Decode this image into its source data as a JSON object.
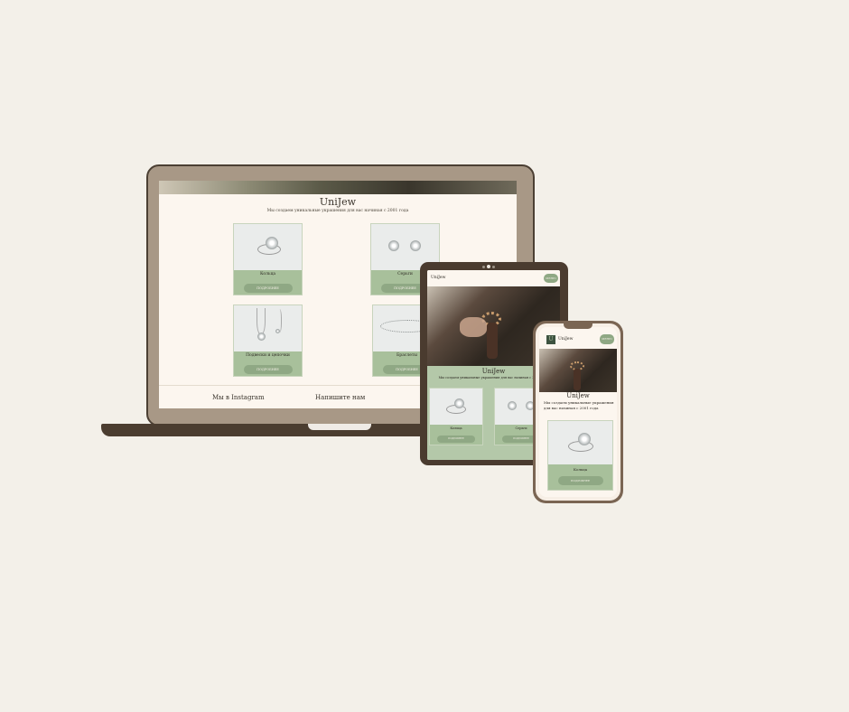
{
  "site": {
    "brand": "UniJew",
    "tagline": "Мы создаем уникальные украшения для вас начиная с 2001 года",
    "menu_label": "МЕНЮ",
    "logo_mark": "U"
  },
  "products": [
    {
      "name": "Кольца",
      "button": "ПОДРОБНЕЕ"
    },
    {
      "name": "Серьги",
      "button": "ПОДРОБНЕЕ"
    },
    {
      "name": "Подвески и цепочки",
      "button": "ПОДРОБНЕЕ"
    },
    {
      "name": "Браслеты",
      "button": "ПОДРОБНЕЕ"
    }
  ],
  "footer": {
    "instagram": "Мы в Instagram",
    "write": "Напишите нам"
  },
  "colors": {
    "background": "#f3f0e9",
    "page": "#fcf6ef",
    "card_green": "#a8c09b",
    "button_green": "#8fa884",
    "device_brown": "#4b3d30"
  }
}
